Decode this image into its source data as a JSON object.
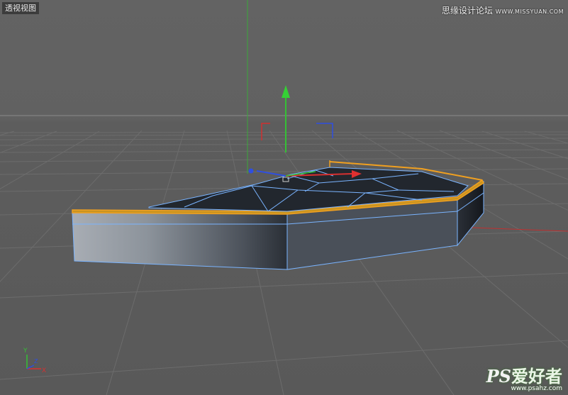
{
  "viewport": {
    "label": "透视视图",
    "background": "#5f5f5f"
  },
  "watermarks": {
    "top_cn": "思缘设计论坛",
    "top_en": "WWW.MISSYUAN.COM",
    "bottom_ps": "PS",
    "bottom_cn": "爱好者",
    "bottom_url": "www.psahz.com"
  },
  "axis_indicator": {
    "x_label": "X",
    "y_label": "Y",
    "z_label": "Z",
    "x_color": "#e0302a",
    "y_color": "#35c035",
    "z_color": "#2f4fe0"
  },
  "scene": {
    "object": "shield-shaped extruded polygon",
    "selection_color": "#f0a020",
    "wireframe_color": "#7ab4ff"
  }
}
